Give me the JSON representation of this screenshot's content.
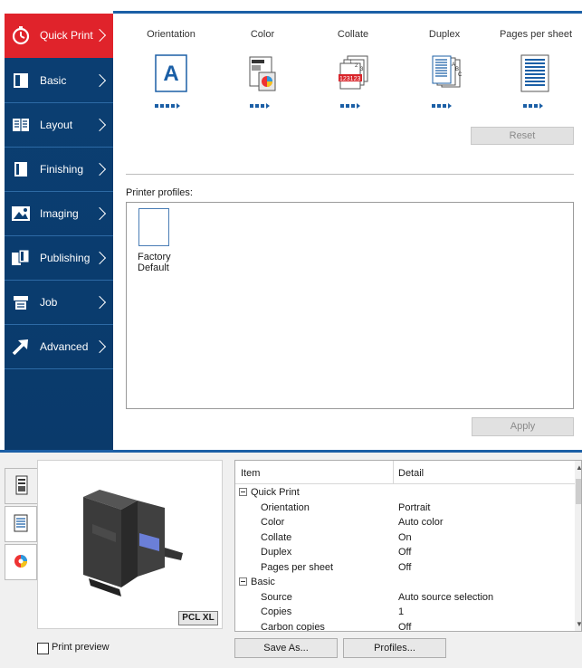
{
  "sidebar": {
    "items": [
      {
        "label": "Quick Print",
        "icon": "stopwatch-icon"
      },
      {
        "label": "Basic",
        "icon": "page-icon"
      },
      {
        "label": "Layout",
        "icon": "layout-icon"
      },
      {
        "label": "Finishing",
        "icon": "finishing-icon"
      },
      {
        "label": "Imaging",
        "icon": "image-icon"
      },
      {
        "label": "Publishing",
        "icon": "publishing-icon"
      },
      {
        "label": "Job",
        "icon": "job-icon"
      },
      {
        "label": "Advanced",
        "icon": "arrow-icon"
      }
    ]
  },
  "quick_print": {
    "columns": [
      "Orientation",
      "Color",
      "Collate",
      "Duplex",
      "Pages per sheet"
    ],
    "orientation_letter": "A",
    "collate_numbers": [
      "1",
      "2",
      "3"
    ],
    "collate_red": "123123",
    "duplex_letters": [
      "A",
      "B",
      "C"
    ],
    "reset_label": "Reset"
  },
  "profiles": {
    "label": "Printer profiles:",
    "items": [
      {
        "name": "Factory Default"
      }
    ],
    "apply_label": "Apply"
  },
  "preview": {
    "badge": "PCL XL",
    "print_preview_label": "Print preview"
  },
  "settings_grid": {
    "headers": {
      "item": "Item",
      "detail": "Detail"
    },
    "rows": [
      {
        "item": "Quick Print",
        "detail": "",
        "group": true
      },
      {
        "item": "Orientation",
        "detail": "Portrait",
        "group": false
      },
      {
        "item": "Color",
        "detail": "Auto color",
        "group": false
      },
      {
        "item": "Collate",
        "detail": "On",
        "group": false
      },
      {
        "item": "Duplex",
        "detail": "Off",
        "group": false
      },
      {
        "item": "Pages per sheet",
        "detail": "Off",
        "group": false
      },
      {
        "item": "Basic",
        "detail": "",
        "group": true
      },
      {
        "item": "Source",
        "detail": "Auto source selection",
        "group": false
      },
      {
        "item": "Copies",
        "detail": "1",
        "group": false
      },
      {
        "item": "Carbon copies",
        "detail": "Off",
        "group": false
      }
    ]
  },
  "footer": {
    "save_as_label": "Save As...",
    "profiles_label": "Profiles..."
  },
  "colors": {
    "accent_red": "#e0232b",
    "sidebar_blue": "#0b3f73",
    "brand_blue": "#1b5fa6"
  }
}
